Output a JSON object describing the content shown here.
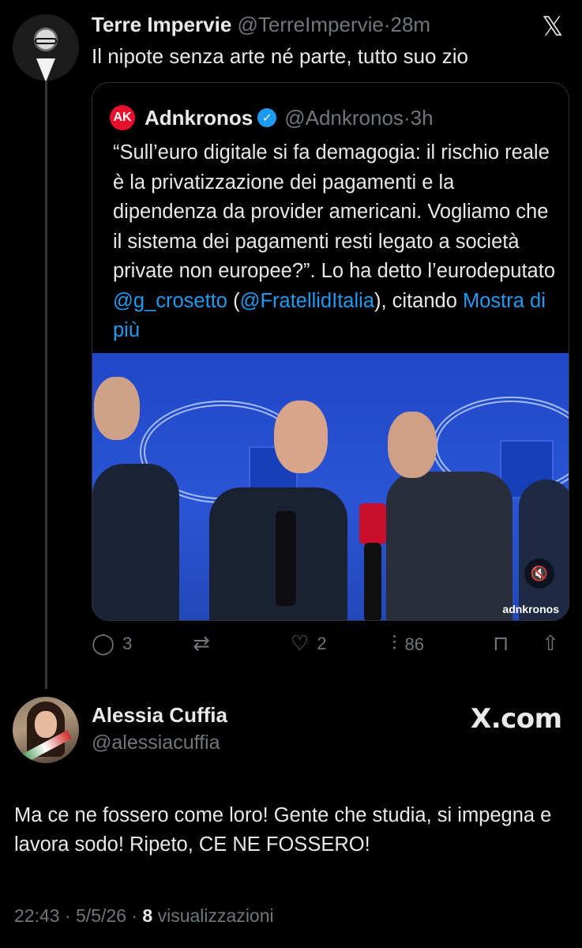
{
  "tweet": {
    "author_name": "Terre Impervie",
    "author_handle": "@TerreImpervie",
    "separator": "·",
    "time": "28m",
    "text": "Il nipote senza arte né parte, tutto suo zio",
    "x_icon": "x-logo-icon"
  },
  "quoted": {
    "author_name": "Adnkronos",
    "author_handle": "@Adnkronos",
    "separator": "·",
    "time": "3h",
    "logo_text": "AK",
    "text_part1": "“Sull’euro digitale si fa demagogia: il rischio reale è la privatizzazione dei pagamenti e la dipendenza da provider americani. Vogliamo che il sistema dei pagamenti resti legato a società private non europee?”. Lo ha detto l’eurodeputato ",
    "mention1": "@g_crosetto",
    "text_part2": "(",
    "mention2": "@FratellidItalia",
    "text_part3": "), citando ",
    "show_more": "Mostra di più",
    "media_watermark": "adnkronos",
    "mute_icon": "speaker-muted-icon"
  },
  "actions": {
    "replies": "3",
    "retweets": "",
    "likes": "2",
    "views": "86"
  },
  "reply": {
    "author_name": "Alessia Cuffia",
    "author_handle": "@alessiacuffia",
    "brand": "X.com",
    "text": "Ma ce ne fossero come loro! Gente che studia, si impegna e lavora sodo! Ripeto, CE NE FOSSERO!",
    "time": "22:43",
    "date": "5/5/26",
    "views_count": "8",
    "views_label": "visualizzazioni"
  },
  "colors": {
    "background": "#000000",
    "text": "#e7e9ea",
    "muted": "#71767b",
    "link": "#1d9bf0",
    "brand_red": "#e8112d"
  }
}
